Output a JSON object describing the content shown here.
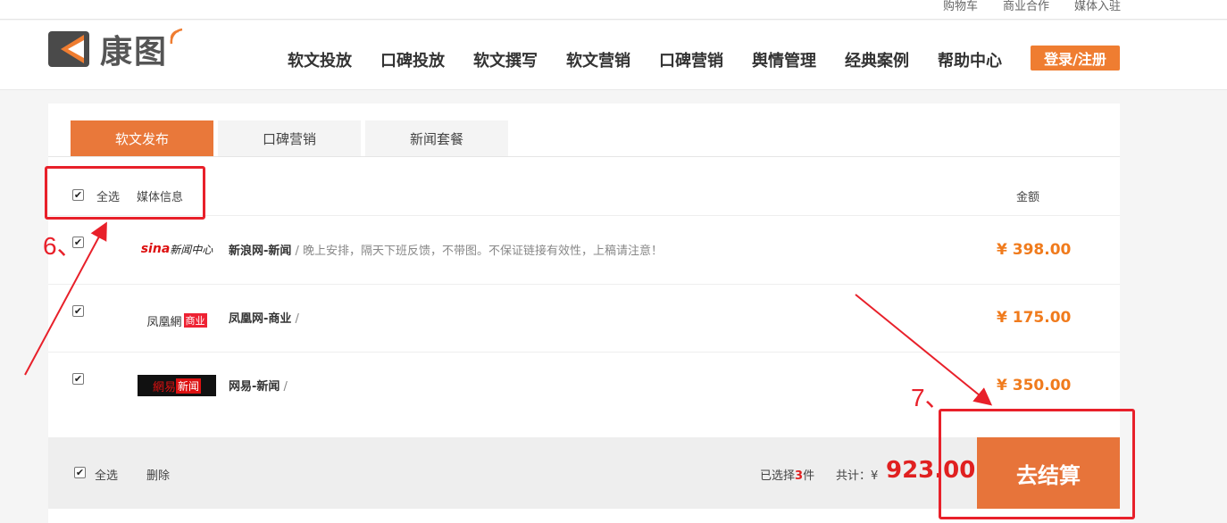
{
  "topbar": {
    "links": [
      "购物车",
      "商业合作",
      "媒体入驻"
    ]
  },
  "header": {
    "logo_text": "康图",
    "nav": [
      "软文投放",
      "口碑投放",
      "软文撰写",
      "软文营销",
      "口碑营销",
      "舆情管理",
      "经典案例",
      "帮助中心"
    ],
    "login_label": "登录/注册"
  },
  "tabs": [
    {
      "label": "软文发布",
      "active": true
    },
    {
      "label": "口碑营销",
      "active": false
    },
    {
      "label": "新闻套餐",
      "active": false
    }
  ],
  "list_header": {
    "select_all": "全选",
    "media_info": "媒体信息",
    "amount": "金额"
  },
  "items": [
    {
      "logo": "sina新闻中心",
      "name": "新浪网-新闻",
      "desc": " / 晚上安排，隔天下班反馈，不带图。不保证链接有效性，上稿请注意！",
      "price": "¥ 398.00",
      "checked": true
    },
    {
      "logo": "凤凰網商业",
      "name": "凤凰网-商业",
      "desc": " /",
      "price": "¥ 175.00",
      "checked": true
    },
    {
      "logo": "网易新闻",
      "name": "网易-新闻",
      "desc": " /",
      "price": "¥ 350.00",
      "checked": true
    }
  ],
  "footer": {
    "select_all": "全选",
    "delete": "删除",
    "selected_prefix": "已选择",
    "selected_count": "3",
    "selected_suffix": "件",
    "total_label": "共计：¥",
    "total_value": "923.00",
    "checkout_label": "去结算"
  },
  "annotations": {
    "step6": "6、",
    "step7": "7、"
  },
  "colors": {
    "accent": "#e9783a",
    "price": "#f07b1d",
    "total": "#e02020",
    "annotation": "#e8202a"
  }
}
